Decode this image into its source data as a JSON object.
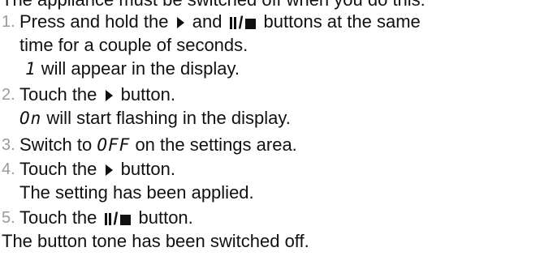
{
  "intro_text": "The appliance must be switched off when you do this:",
  "steps": [
    {
      "number": "1.",
      "line1_a": "Press and hold the",
      "line1_b": "and",
      "line1_c": "buttons at the same",
      "line2": "time for a couple of seconds.",
      "display_symbol": "1",
      "line3_rest": " will appear in the display."
    },
    {
      "number": "2.",
      "line1_a": "Touch the",
      "line1_b": "button.",
      "display_symbol": "On",
      "line2_rest": " will start flashing in the display."
    },
    {
      "number": "3.",
      "line1_a": "Switch to",
      "display_symbol": "OFF",
      "line1_b": " on the settings area."
    },
    {
      "number": "4.",
      "line1_a": "Touch the",
      "line1_b": "button.",
      "line2": "The setting has been applied."
    },
    {
      "number": "5.",
      "line1_a": "Touch the",
      "line1_b": "button."
    }
  ],
  "closing_text": "The button tone has been switched off.",
  "icons": {
    "play": "play-triangle-icon",
    "pause_stop": "pause-stop-icon"
  }
}
